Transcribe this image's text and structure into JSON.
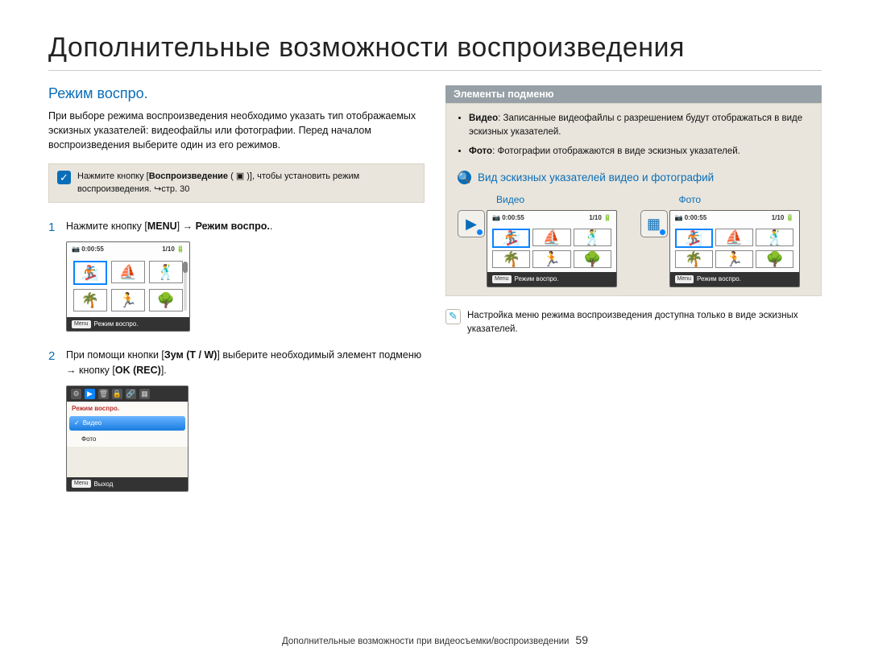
{
  "title": "Дополнительные возможности воспроизведения",
  "left": {
    "heading": "Режим воспро.",
    "intro": "При выборе режима воспроизведения необходимо указать тип отображаемых эскизных указателей: видеофайлы или фотографии. Перед началом воспроизведения выберите один из его режимов.",
    "note_prefix": "Нажмите кнопку [",
    "note_bold": "Воспроизведение",
    "note_between": " ( ▣ )], чтобы установить режим воспроизведения. ↪стр. 30",
    "step1_prefix": "Нажмите кнопку [",
    "step1_b1": "MENU",
    "step1_mid": "] → ",
    "step1_b2": "Режим воспро.",
    "step1_suffix": ".",
    "lcd1_time": "0:00:55",
    "lcd1_count": "1/10",
    "lcd1_footer_chip": "Menu",
    "lcd1_footer": "Режим воспро.",
    "step2_a": "При помощи кнопки [",
    "step2_b1": "Зум (T / W)",
    "step2_b": "] выберите необходимый элемент подменю → кнопку [",
    "step2_b2": "OK (REC)",
    "step2_c": "].",
    "lcd2_menu_head": "Режим воспро.",
    "lcd2_item1": "Видео",
    "lcd2_item2": "Фото",
    "lcd2_exit_chip": "Menu",
    "lcd2_exit": "Выход"
  },
  "right": {
    "submenu_title": "Элементы подменю",
    "bullets": {
      "b1_b": "Видео",
      "b1_t": ": Записанные видеофайлы с разрешением будут отображаться в виде эскизных указателей.",
      "b2_b": "Фото",
      "b2_t": ": Фотографии отображаются в виде эскизных указателей."
    },
    "tv_title": "Вид эскизных указателей видео и фотографий",
    "tv_video": "Видео",
    "tv_photo": "Фото",
    "lcd_time": "0:00:55",
    "lcd_count": "1/10",
    "lcd_footer": "Режим воспро.",
    "lcd_chip": "Menu",
    "bottom_note": "Настройка меню режима воспроизведения доступна только в виде эскизных указателей."
  },
  "footer": {
    "text": "Дополнительные возможности при видеосъемки/воспроизведении",
    "page": "59"
  }
}
